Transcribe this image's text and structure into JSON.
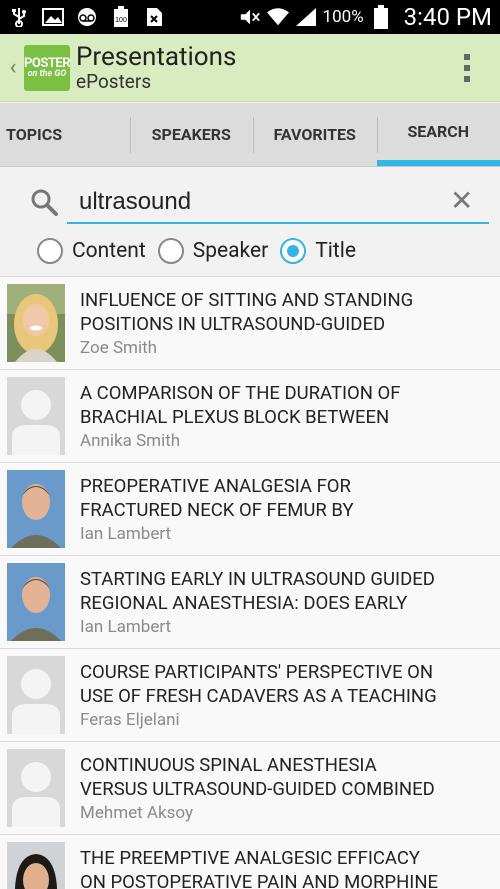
{
  "status_bar": {
    "battery_pct": "100%",
    "time": "3:40 PM",
    "left_icons": [
      "usb-icon",
      "image-icon",
      "voicemail-icon",
      "battery-full-icon",
      "document-icon"
    ],
    "right_icons": [
      "mute-icon",
      "wifi-icon",
      "signal-icon",
      "battery-icon"
    ]
  },
  "action_bar": {
    "title": "Presentations",
    "subtitle": "ePosters",
    "logo_line1": "POSTER",
    "logo_line2": "on the GO",
    "back_icon": "chevron-left-icon",
    "overflow_icon": "overflow-menu-icon",
    "background": "#d9ecc0"
  },
  "tabs": [
    {
      "label": "TOPICS",
      "active": false
    },
    {
      "label": "SPEAKERS",
      "active": false
    },
    {
      "label": "FAVORITES",
      "active": false
    },
    {
      "label": "SEARCH",
      "active": true
    }
  ],
  "search": {
    "value": "ultrasound",
    "placeholder": "",
    "options": [
      {
        "label": "Content",
        "checked": false
      },
      {
        "label": "Speaker",
        "checked": false
      },
      {
        "label": "Title",
        "checked": true
      }
    ],
    "accent": "#33b5e5"
  },
  "results": [
    {
      "title_line1": "INFLUENCE OF SITTING AND STANDING",
      "title_line2": "POSITIONS IN ULTRASOUND-GUIDED",
      "speaker": "Zoe Smith",
      "avatar": "photo-blonde-woman"
    },
    {
      "title_line1": "A COMPARISON OF THE DURATION OF",
      "title_line2": "BRACHIAL PLEXUS BLOCK BETWEEN",
      "speaker": "Annika Smith",
      "avatar": "placeholder"
    },
    {
      "title_line1": "PREOPERATIVE ANALGESIA FOR",
      "title_line2": "FRACTURED NECK OF FEMUR BY",
      "speaker": "Ian Lambert",
      "avatar": "photo-man"
    },
    {
      "title_line1": "STARTING EARLY IN ULTRASOUND GUIDED",
      "title_line2": "REGIONAL ANAESTHESIA: DOES EARLY",
      "speaker": "Ian Lambert",
      "avatar": "photo-man"
    },
    {
      "title_line1": "COURSE PARTICIPANTS' PERSPECTIVE ON",
      "title_line2": "USE OF FRESH CADAVERS AS A TEACHING",
      "speaker": "Feras Eljelani",
      "avatar": "placeholder"
    },
    {
      "title_line1": "CONTINUOUS SPINAL ANESTHESIA",
      "title_line2": "VERSUS ULTRASOUND-GUIDED COMBINED",
      "speaker": "Mehmet Aksoy",
      "avatar": "placeholder"
    },
    {
      "title_line1": "THE PREEMPTIVE ANALGESIC EFFICACY",
      "title_line2": "ON POSTOPERATIVE PAIN AND MORPHINE",
      "speaker": "",
      "avatar": "photo-dark-hair-woman"
    }
  ]
}
